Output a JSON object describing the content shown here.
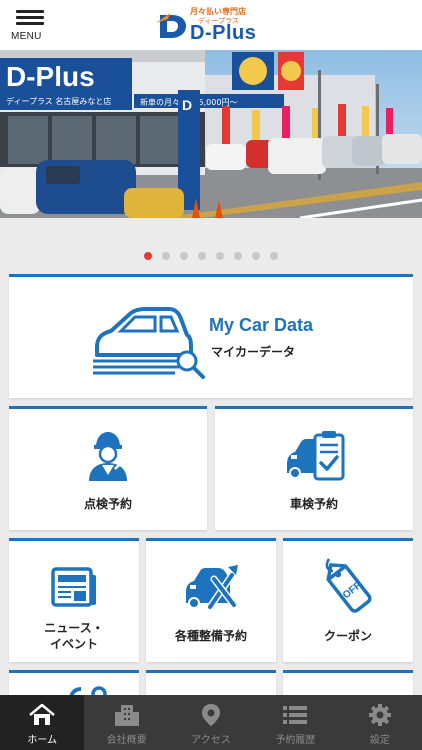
{
  "header": {
    "menu_label": "MENU",
    "logo_sub": "月々払い専門店",
    "logo_kana": "ディープラス",
    "logo_text": "D-Plus"
  },
  "hero": {
    "sign_main": "D-Plus",
    "sign_sub": "ディープラス  名古屋みなと店",
    "pole_sign": "ディープラス",
    "banner": "新車の月々払い 5,000円〜"
  },
  "carousel": {
    "count": 8,
    "active_index": 0
  },
  "main_tile": {
    "title": "My Car Data",
    "subtitle": "マイカーデータ"
  },
  "tiles": [
    {
      "label": "点検予約"
    },
    {
      "label": "車検予約"
    },
    {
      "label_line1": "ニュース・",
      "label_line2": "イベント"
    },
    {
      "label": "各種整備予約"
    },
    {
      "label": "クーポン"
    }
  ],
  "tabbar": [
    {
      "label": "ホーム",
      "icon": "home-icon",
      "active": true
    },
    {
      "label": "会社概要",
      "icon": "building-icon",
      "active": false
    },
    {
      "label": "アクセス",
      "icon": "map-pin-icon",
      "active": false
    },
    {
      "label": "予約履歴",
      "icon": "list-icon",
      "active": false
    },
    {
      "label": "設定",
      "icon": "gear-icon",
      "active": false
    }
  ],
  "colors": {
    "accent": "#1e73be",
    "active_dot": "#e53935",
    "tabbar": "#3a3a3a"
  }
}
